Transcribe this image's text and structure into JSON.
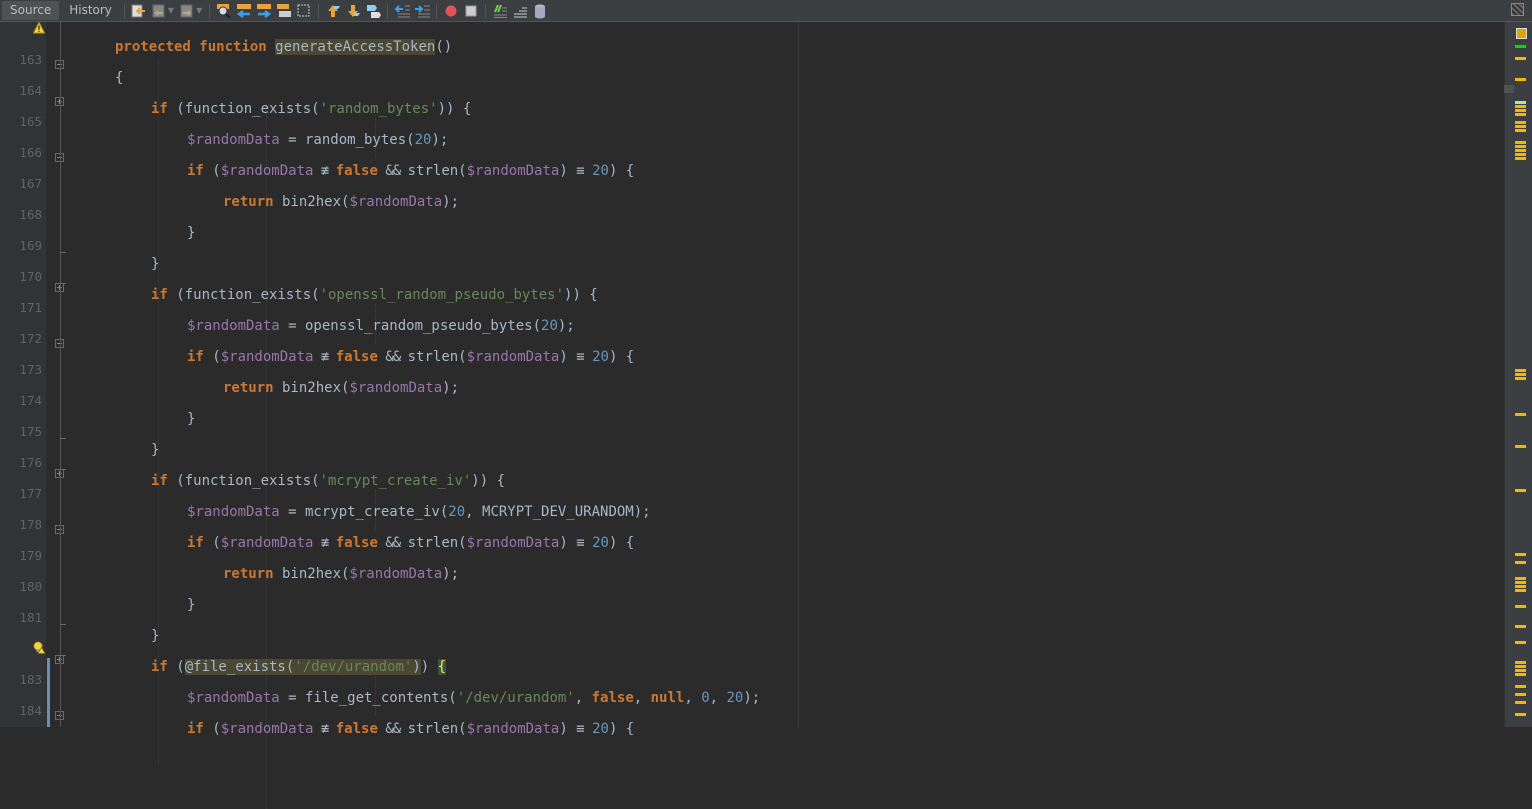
{
  "toolbar": {
    "tabs": [
      {
        "label": "Source",
        "active": true
      },
      {
        "label": "History",
        "active": false
      }
    ],
    "buttons": [
      "last-edit-icon",
      "back-icon",
      "forward-icon",
      "find-icon",
      "find-previous-icon",
      "find-next-icon",
      "toggle-highlight-icon",
      "toggle-rectangular-selection-icon",
      "previous-bookmark-icon",
      "next-bookmark-icon",
      "toggle-bookmark-icon",
      "shift-left-icon",
      "shift-right-icon",
      "start-macro-recording-icon",
      "stop-macro-recording-icon",
      "comment-icon",
      "uncomment-icon",
      "database-icon"
    ]
  },
  "editor": {
    "lines": [
      {
        "num": "",
        "gutter_icon": "warning-icon"
      },
      {
        "num": "163"
      },
      {
        "num": "164"
      },
      {
        "num": "165"
      },
      {
        "num": "166"
      },
      {
        "num": "167"
      },
      {
        "num": "168"
      },
      {
        "num": "169"
      },
      {
        "num": "170"
      },
      {
        "num": "171"
      },
      {
        "num": "172"
      },
      {
        "num": "173"
      },
      {
        "num": "174"
      },
      {
        "num": "175"
      },
      {
        "num": "176"
      },
      {
        "num": "177"
      },
      {
        "num": "178"
      },
      {
        "num": "179"
      },
      {
        "num": "180"
      },
      {
        "num": "181"
      },
      {
        "num": "",
        "gutter_icon": "bulb-warning-icon"
      },
      {
        "num": "183"
      },
      {
        "num": "184"
      }
    ],
    "code": {
      "l162": {
        "k1": "protected",
        "k2": "function",
        "name": "generateAccessToken",
        "rest": "()"
      },
      "l163": "{",
      "l164": {
        "kw": "if",
        "pre": " (function_exists(",
        "str": "'random_bytes'",
        "post": ")) {"
      },
      "l165": {
        "var": "$randomData",
        "pre": " = random_bytes(",
        "num": "20",
        "post": ");"
      },
      "cond": {
        "kw": "if",
        "open": " (",
        "var": "$randomData",
        "neq": " ≢ ",
        "false": "false",
        "and": " && ",
        "strlen": "strlen(",
        "close1": ") ",
        "eq": "≡",
        "num": "20",
        "close2": ") {"
      },
      "ret": {
        "kw": "return",
        "pre": " bin2hex(",
        "var": "$randomData",
        "post": ");"
      },
      "close": "}",
      "l170": {
        "kw": "if",
        "pre": " (function_exists(",
        "str": "'openssl_random_pseudo_bytes'",
        "post": ")) {"
      },
      "l171": {
        "var": "$randomData",
        "pre": " = openssl_random_pseudo_bytes(",
        "num": "20",
        "post": ");"
      },
      "l176": {
        "kw": "if",
        "pre": " (function_exists(",
        "str": "'mcrypt_create_iv'",
        "post": ")) {"
      },
      "l177": {
        "var": "$randomData",
        "pre": " = mcrypt_create_iv(",
        "num": "20",
        "mid": ", MCRYPT_DEV_URANDOM);"
      },
      "l182": {
        "kw": "if",
        "pre": " (",
        "hl": "@file_exists(",
        "str": "'/dev/urandom'",
        "hlclose": ")",
        "post": ") ",
        "brace": "{"
      },
      "l183": {
        "var": "$randomData",
        "pre": " = file_get_contents(",
        "str": "'/dev/urandom'",
        "c1": ", ",
        "false": "false",
        "c2": ", ",
        "null": "null",
        "c3": ", ",
        "n0": "0",
        "c4": ", ",
        "n20": "20",
        "post": ");"
      }
    }
  },
  "colors": {
    "keyword": "#cc7832",
    "string": "#6a8759",
    "number": "#6897bb",
    "variable": "#9876aa",
    "text": "#a9b7c6",
    "background": "#2b2b2b",
    "warning_mark": "#f5b500"
  }
}
